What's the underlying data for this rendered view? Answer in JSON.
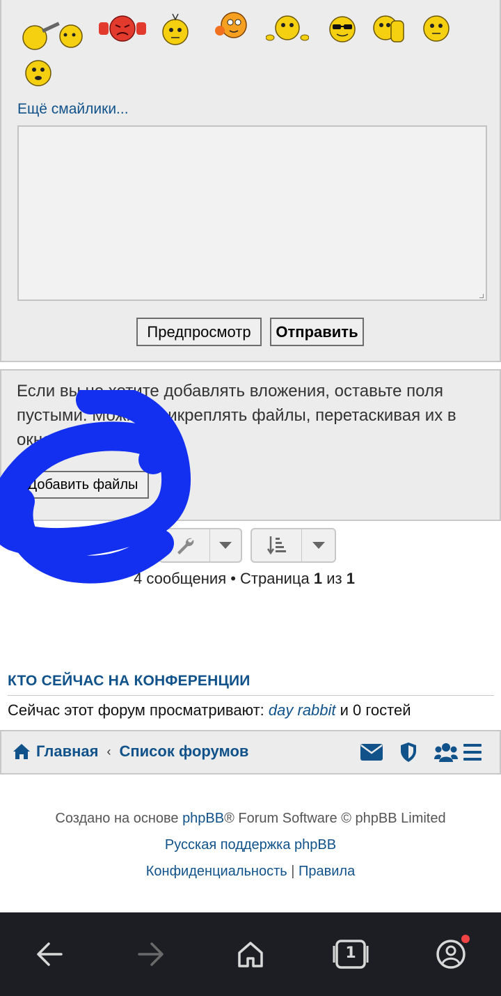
{
  "reply": {
    "more_smilies": "Ещё смайлики...",
    "preview_label": "Предпросмотр",
    "submit_label": "Отправить"
  },
  "attachments": {
    "help_text": "Если вы не хотите добавлять вложения, оставьте поля пустыми. Можно прикреплять файлы, перетаскивая их в окно сообщения.",
    "add_files_label": "Добавить файлы"
  },
  "topic_tools": {
    "tools_icon": "wrench-icon",
    "sort_icon": "sort-icon"
  },
  "pagination": {
    "count_text": "4 сообщения • Страница ",
    "current": "1",
    "of": " из ",
    "total": "1"
  },
  "online": {
    "heading": "КТО СЕЙЧАС НА КОНФЕРЕНЦИИ",
    "prefix": "Сейчас этот форум просматривают: ",
    "user": "day rabbit",
    "suffix": " и 0 гостей"
  },
  "navbar": {
    "home": "Главная",
    "separator": "‹",
    "forum_list": "Список форумов"
  },
  "footer": {
    "powered_prefix": "Создано на основе ",
    "phpbb": "phpBB",
    "powered_suffix": "® Forum Software © phpBB Limited",
    "russian_support": "Русская поддержка phpBB",
    "privacy": "Конфиденциальность",
    "divider": "|",
    "rules": "Правила"
  },
  "browser": {
    "tab_count": "1"
  },
  "colors": {
    "link": "#105289",
    "panel_bg": "#ececec",
    "scribble": "#1330f0",
    "browser_bar": "#1c1e23"
  }
}
